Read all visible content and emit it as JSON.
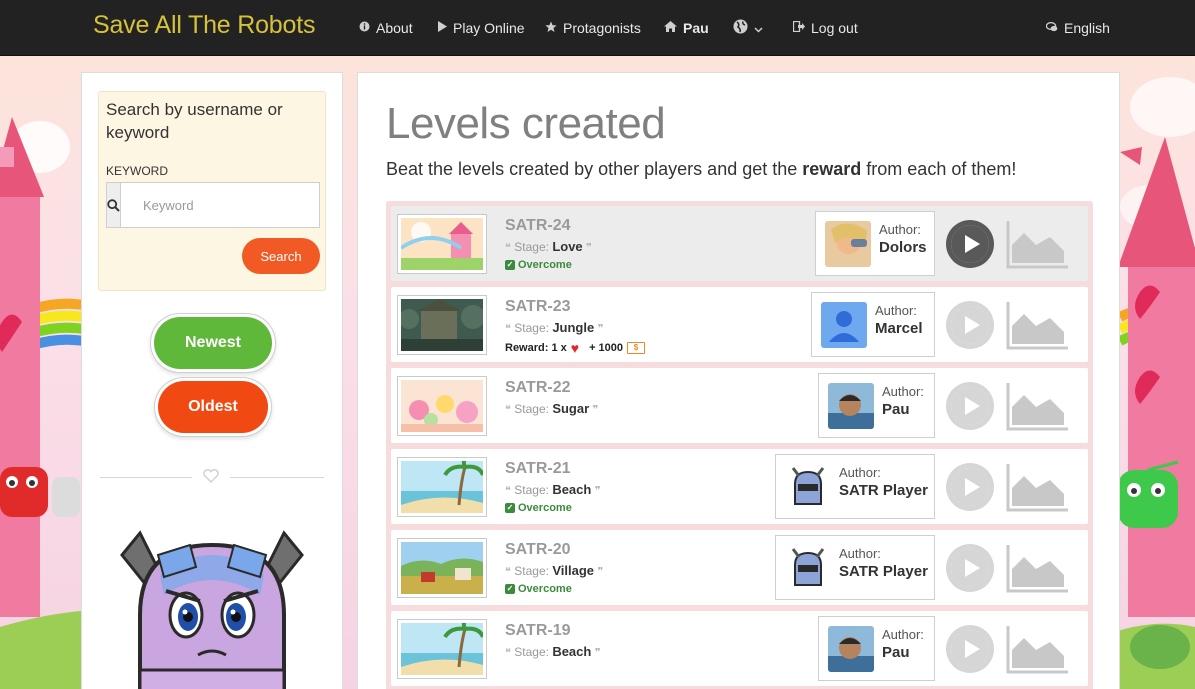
{
  "navbar": {
    "brand": "Save All The Robots",
    "items": [
      {
        "icon": "info-icon",
        "label": "About"
      },
      {
        "icon": "play-icon",
        "label": "Play Online"
      },
      {
        "icon": "star-icon",
        "label": "Protagonists"
      },
      {
        "icon": "home-icon",
        "label": "Pau"
      },
      {
        "icon": "globe-icon",
        "label": ""
      },
      {
        "icon": "logout-icon",
        "label": "Log out"
      }
    ],
    "language": {
      "icon": "chat-icon",
      "label": "English"
    }
  },
  "sidebar": {
    "search_title": "Search by username or keyword",
    "keyword_label": "KEYWORD",
    "keyword_placeholder": "Keyword",
    "keyword_value": "",
    "search_button": "Search",
    "sort_newest": "Newest",
    "sort_oldest": "Oldest"
  },
  "main": {
    "title": "Levels created",
    "subtitle_pre": "Beat the levels created by other players and get the ",
    "subtitle_bold": "reward",
    "subtitle_post": " from each of them!",
    "stage_label": "Stage:",
    "author_label": "Author:",
    "overcome_label": "Overcome",
    "levels": [
      {
        "name": "SATR-24",
        "stage": "Love",
        "status": "Overcome",
        "author": "Dolors",
        "active": true
      },
      {
        "name": "SATR-23",
        "stage": "Jungle",
        "reward_text": "Reward: 1 x",
        "reward_lives": "1",
        "reward_coins": "+ 1000",
        "author": "Marcel",
        "active": false
      },
      {
        "name": "SATR-22",
        "stage": "Sugar",
        "status": "",
        "author": "Pau",
        "active": false
      },
      {
        "name": "SATR-21",
        "stage": "Beach",
        "status": "Overcome",
        "author": "SATR Player",
        "active": false
      },
      {
        "name": "SATR-20",
        "stage": "Village",
        "status": "Overcome",
        "author": "SATR Player",
        "active": false
      },
      {
        "name": "SATR-19",
        "stage": "Beach",
        "status": "",
        "author": "Pau",
        "active": false
      }
    ]
  },
  "colors": {
    "navbar_bg": "#222222",
    "brand": "#d6c13b",
    "search_button": "#f15a24",
    "newest": "#5fb83a",
    "oldest": "#f04a12",
    "levels_bg": "#f6dcdc",
    "overcome": "#3c8a3c"
  }
}
